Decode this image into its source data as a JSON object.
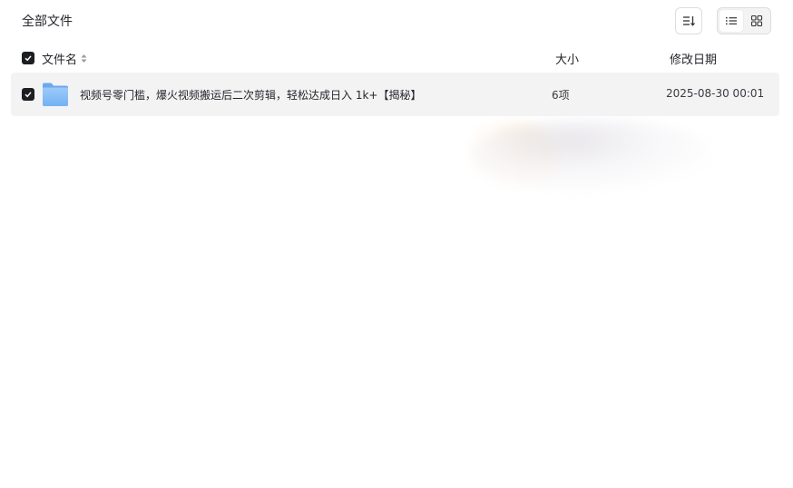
{
  "breadcrumb": {
    "label": "全部文件"
  },
  "toolbar": {
    "sort_icon": "sort-icon",
    "view_list_icon": "list-view-icon",
    "view_grid_icon": "grid-view-icon",
    "active_view": "list"
  },
  "table": {
    "columns": {
      "name": "文件名",
      "size": "大小",
      "modified": "修改日期"
    },
    "header_checked": true,
    "rows": [
      {
        "checked": true,
        "type": "folder",
        "icon": "folder-icon",
        "name": "视频号零门槛，爆火视频搬运后二次剪辑，轻松达成日入 1k+【揭秘】",
        "size": "6项",
        "modified": "2025-08-30 00:01"
      }
    ]
  },
  "colors": {
    "checkbox": "#1d1e22",
    "row_selected_bg": "#f3f3f4",
    "folder_blue": "#7fb8f7",
    "text": "#25262b"
  }
}
